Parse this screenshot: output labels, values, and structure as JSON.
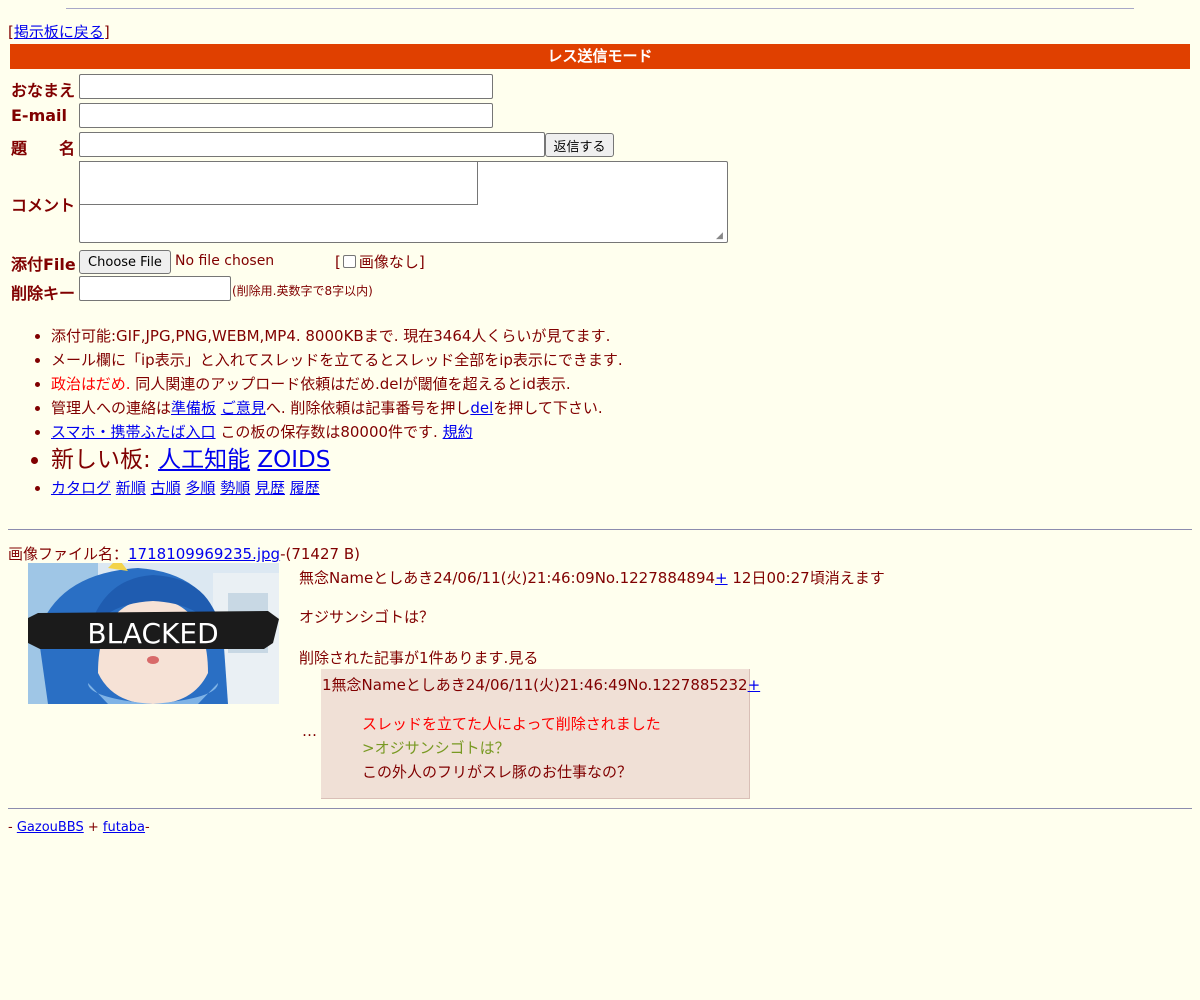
{
  "nav": {
    "back_link": "掲示板に戻る"
  },
  "form": {
    "mode_title": "レス送信モード",
    "name_label": "おなまえ",
    "email_label": "E-mail",
    "subject_label": "題　　名",
    "submit_label": "返信する",
    "comment_label": "コメント",
    "file_label": "添付File",
    "choose_file_label": "Choose File",
    "no_file_text": "No file chosen",
    "no_image_label": "画像なし",
    "delkey_label": "削除キー",
    "delkey_note": "(削除用.英数字で8字以内)"
  },
  "rules": {
    "r1": "添付可能:GIF,JPG,PNG,WEBM,MP4. 8000KBまで. 現在3464人くらいが見てます.",
    "r2": "メール欄に「ip表示」と入れてスレッドを立てるとスレッド全部をip表示にできます.",
    "r3_red": "政治はだめ.",
    "r3_rest": " 同人関連のアップロード依頼はだめ.delが閾値を超えるとid表示.",
    "r4_a": "管理人への連絡は",
    "r4_link1": "準備板",
    "r4_link2": "ご意見",
    "r4_b": "へ. 削除依頼は記事番号を押し",
    "r4_link3": "del",
    "r4_c": "を押して下さい.",
    "r5_link": "スマホ・携帯ふたば入口",
    "r5_text": " この板の保存数は80000件です. ",
    "r5_link2": "規約",
    "new_boards_label": "新しい板: ",
    "new_board_1": "人工知能",
    "new_board_2": "ZOIDS",
    "sort_links": [
      "カタログ",
      "新順",
      "古順",
      "多順",
      "勢順",
      "見歴",
      "履歴"
    ]
  },
  "thread": {
    "file_label": "画像ファイル名：",
    "file_name": "1718109969235.jpg",
    "file_size": "-(71427 B)",
    "thumb_text": "BLACKED",
    "head": "無念Nameとしあき24/06/11(火)21:46:09No.1227884894",
    "plus": "+",
    "expire": " 12日00:27頃消えます",
    "body": "オジサンシゴトは？",
    "deleted_note": "削除された記事が1件あります.見る",
    "dots": "…"
  },
  "reply": {
    "head": "1無念Nameとしあき24/06/11(火)21:46:49No.1227885232",
    "plus": "+",
    "deleted_msg": "スレッドを立てた人によって削除されました",
    "quote": ">オジサンシゴトは？",
    "text": "この外人のフリがスレ豚のお仕事なの？"
  },
  "footer": {
    "prefix": "- ",
    "link1": "GazouBBS",
    "sep": " + ",
    "link2": "futaba",
    "suffix": "-"
  },
  "colors": {
    "background": "#ffffee",
    "text": "#800000",
    "header_bar": "#e04000",
    "reply_bg": "#f0e0d6",
    "quote": "#789922",
    "deleted_red": "#ff0000",
    "link": "#0000ee"
  }
}
